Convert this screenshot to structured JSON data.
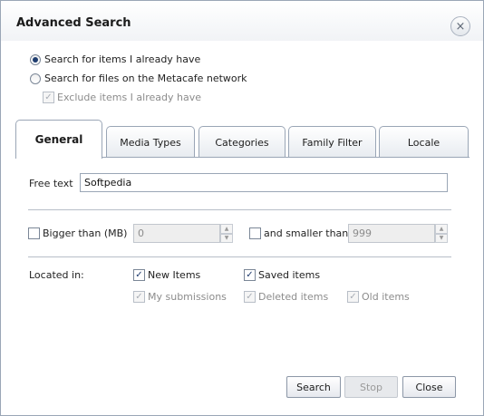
{
  "dialog": {
    "title": "Advanced Search",
    "close_glyph": "×"
  },
  "mode": {
    "option_have": "Search for items I already have",
    "option_network": "Search for files on the Metacafe network",
    "exclude_label": "Exclude items I already have",
    "selected": "have"
  },
  "tabs": [
    {
      "label": "General",
      "active": true
    },
    {
      "label": "Media Types"
    },
    {
      "label": "Categories"
    },
    {
      "label": "Family Filter"
    },
    {
      "label": "Locale"
    }
  ],
  "general": {
    "free_text_label": "Free text",
    "free_text_value": "Softpedia",
    "bigger_label": "Bigger than (MB)",
    "bigger_value": "0",
    "smaller_label": "and smaller than",
    "smaller_value": "999",
    "located_label": "Located in:",
    "locations": {
      "new_items": "New Items",
      "saved_items": "Saved items",
      "my_submissions": "My submissions",
      "deleted_items": "Deleted items",
      "old_items": "Old items"
    }
  },
  "buttons": {
    "search": "Search",
    "stop": "Stop",
    "close": "Close"
  }
}
